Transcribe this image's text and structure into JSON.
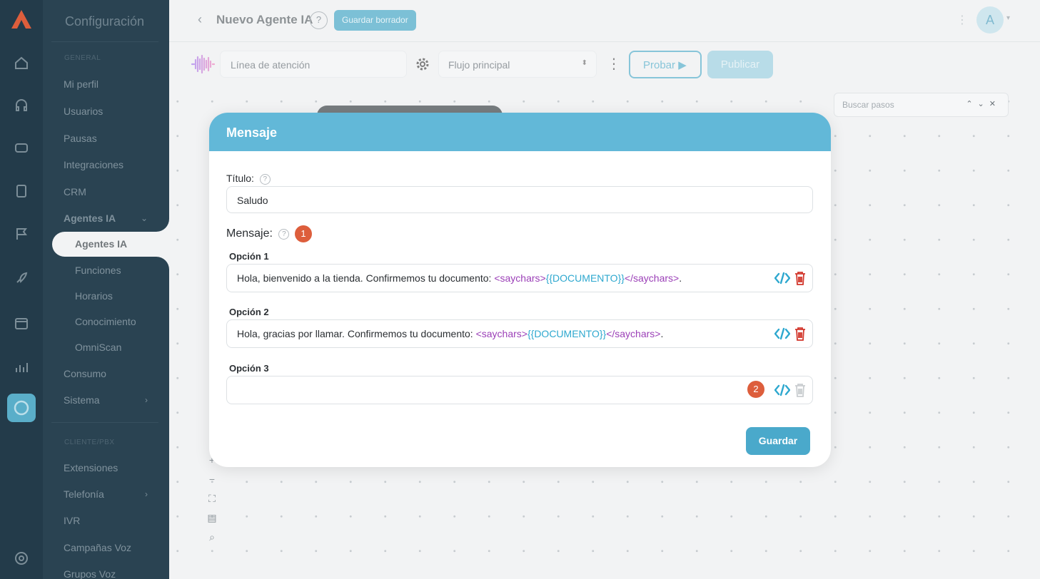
{
  "header": {
    "back_icon": "chevron-left-icon",
    "title": "Nuevo Agente IA",
    "help": "?",
    "draft_button": "Guardar borrador",
    "avatar_initial": "A"
  },
  "sidebar": {
    "title": "Configuración",
    "section_general": "GENERAL",
    "section_telefonia": "CLIENTE/PBX",
    "items": [
      {
        "label": "Mi perfil"
      },
      {
        "label": "Usuarios"
      },
      {
        "label": "Pausas"
      },
      {
        "label": "Integraciones"
      },
      {
        "label": "CRM"
      },
      {
        "label": "Agentes IA"
      },
      {
        "label": "Agentes IA"
      },
      {
        "label": "Funciones"
      },
      {
        "label": "Horarios"
      },
      {
        "label": "Conocimiento"
      },
      {
        "label": "OmniScan"
      },
      {
        "label": "Consumo"
      },
      {
        "label": "Sistema"
      },
      {
        "label": "Extensiones"
      },
      {
        "label": "Telefonía"
      },
      {
        "label": "IVR"
      },
      {
        "label": "Campañas Voz"
      },
      {
        "label": "Grupos Voz"
      }
    ]
  },
  "toolbar": {
    "line_value": "Línea de atención",
    "flow_value": "Flujo principal",
    "test_button": "Probar",
    "publish_button": "Publicar"
  },
  "canvas": {
    "search_placeholder": "Buscar pasos",
    "zoom_in": "+",
    "zoom_out": "−"
  },
  "modal": {
    "title": "Mensaje",
    "title_label": "Título:",
    "title_value": "Saludo",
    "message_label": "Mensaje:",
    "badge1": "1",
    "badge2": "2",
    "options": [
      {
        "label": "Opción 1",
        "text_before": "Hola, bienvenido a la tienda. Confirmemos tu documento: ",
        "tag_open": "<saychars>",
        "variable": "{{DOCUMENTO}}",
        "tag_close": "</saychars>",
        "text_after": "."
      },
      {
        "label": "Opción 2",
        "text_before": "Hola, gracias por llamar. Confirmemos tu documento: ",
        "tag_open": "<saychars>",
        "variable": "{{DOCUMENTO}}",
        "tag_close": "</saychars>",
        "text_after": "."
      },
      {
        "label": "Opción 3",
        "text_before": "",
        "tag_open": "",
        "variable": "",
        "tag_close": "",
        "text_after": ""
      }
    ],
    "save_button": "Guardar"
  },
  "colors": {
    "modal_header": "#62b8d8",
    "accent": "#4aa9cb",
    "badge": "#dd5e3c",
    "tag": "#9b3fb7",
    "variable": "#2ea8cf",
    "trash": "#d2362b"
  }
}
